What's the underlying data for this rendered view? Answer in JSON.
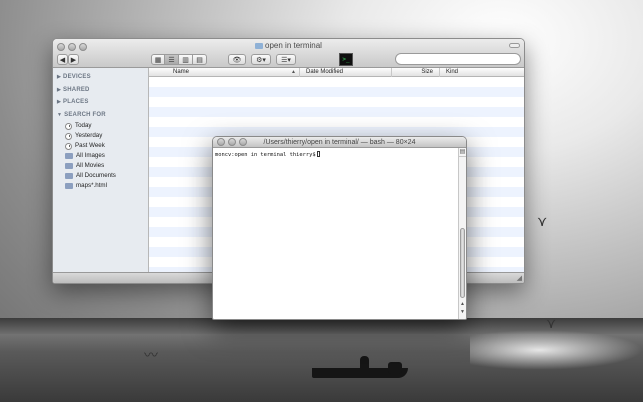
{
  "finder": {
    "title": "open in terminal",
    "toolbar": {
      "back_label": "◀",
      "forward_label": "▶",
      "view_icons": [
        "▦",
        "☰",
        "▥",
        "▤"
      ],
      "eye_label": "👁",
      "action_label": "⚙▾",
      "arrange_label": "☰▾",
      "terminal_icon_text": ">_"
    },
    "search": {
      "placeholder": "",
      "value": ""
    },
    "sidebar": {
      "sections": [
        {
          "label": "DEVICES"
        },
        {
          "label": "SHARED"
        },
        {
          "label": "PLACES"
        },
        {
          "label": "SEARCH FOR"
        }
      ],
      "search_items": [
        {
          "label": "Today",
          "icon": "clock-icon"
        },
        {
          "label": "Yesterday",
          "icon": "clock-icon"
        },
        {
          "label": "Past Week",
          "icon": "clock-icon"
        },
        {
          "label": "All Images",
          "icon": "smart-folder-icon"
        },
        {
          "label": "All Movies",
          "icon": "smart-folder-icon"
        },
        {
          "label": "All Documents",
          "icon": "smart-folder-icon"
        },
        {
          "label": "maps*.html",
          "icon": "smart-folder-icon"
        }
      ]
    },
    "columns": [
      "Name",
      "Date Modified",
      "Size",
      "Kind"
    ]
  },
  "terminal": {
    "title": "/Users/thierry/open in terminal/ — bash — 80×24",
    "prompt": "moncv:open in terminal thierry$"
  },
  "colors": {
    "row_stripe": "#edf3fe",
    "sidebar_bg": "#e7ebf0",
    "terminal_bg": "#ffffff"
  }
}
